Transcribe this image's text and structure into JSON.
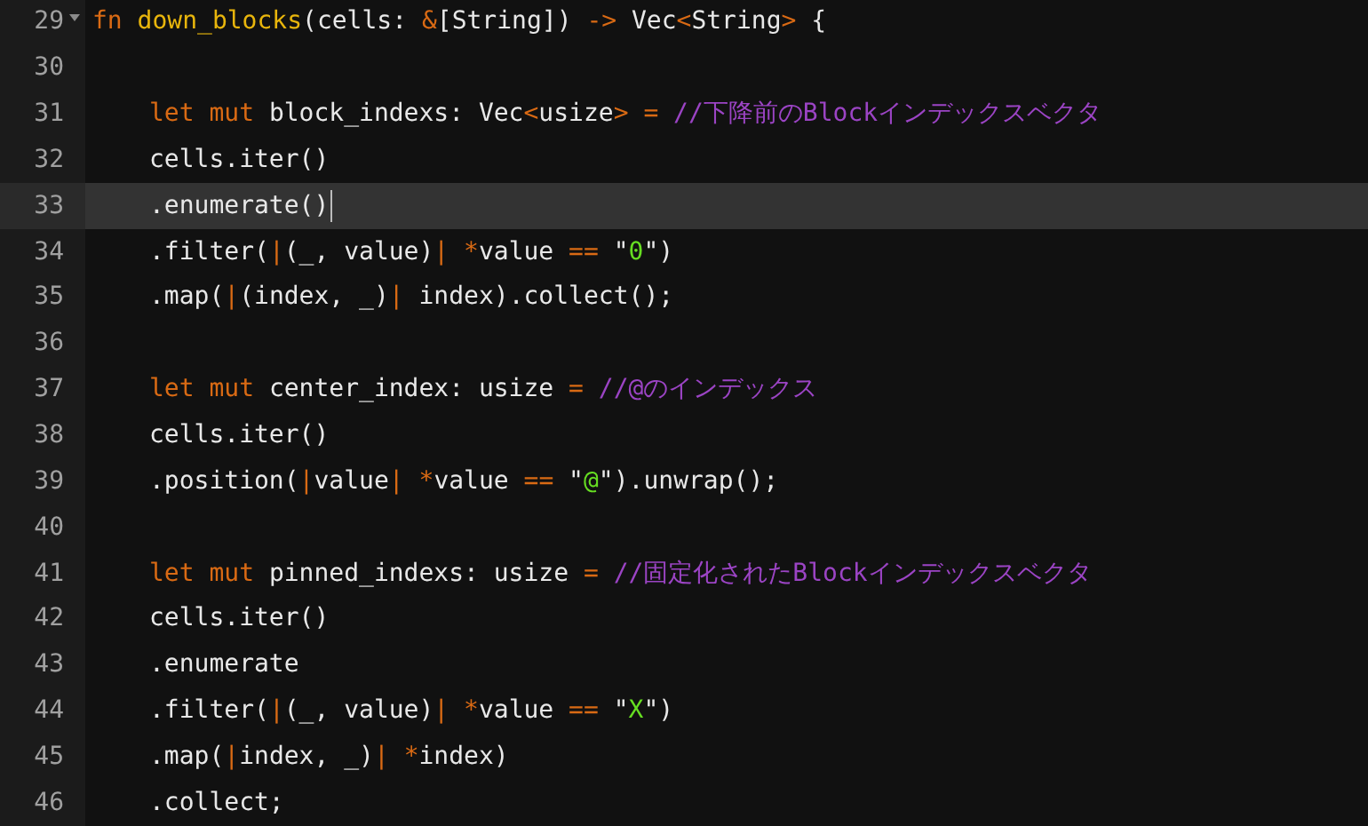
{
  "editor": {
    "lines": [
      {
        "number": "29",
        "foldable": true,
        "current": false,
        "indented": false,
        "tokens": [
          {
            "kind": "keyword",
            "text": "fn "
          },
          {
            "kind": "function",
            "text": "down_blocks"
          },
          {
            "kind": "plain",
            "text": "(cells: "
          },
          {
            "kind": "operator",
            "text": "&"
          },
          {
            "kind": "plain",
            "text": "[String]) "
          },
          {
            "kind": "operator",
            "text": "->"
          },
          {
            "kind": "plain",
            "text": " Vec"
          },
          {
            "kind": "operator",
            "text": "<"
          },
          {
            "kind": "plain",
            "text": "String"
          },
          {
            "kind": "operator",
            "text": ">"
          },
          {
            "kind": "plain",
            "text": " {"
          }
        ]
      },
      {
        "number": "30",
        "foldable": false,
        "current": false
      },
      {
        "number": "31",
        "foldable": false,
        "current": false,
        "indented": true,
        "tokens": [
          {
            "kind": "keyword",
            "text": "let mut"
          },
          {
            "kind": "plain",
            "text": " block_indexs: Vec"
          },
          {
            "kind": "operator",
            "text": "<"
          },
          {
            "kind": "plain",
            "text": "usize"
          },
          {
            "kind": "operator",
            "text": "> "
          },
          {
            "kind": "operator",
            "text": "= "
          },
          {
            "kind": "comment",
            "text": "//下降前のBlockインデックスベクタ"
          }
        ]
      },
      {
        "number": "32",
        "foldable": false,
        "current": false,
        "indented": true,
        "tokens": [
          {
            "kind": "plain",
            "text": "cells.iter()"
          }
        ]
      },
      {
        "number": "33",
        "foldable": false,
        "current": true,
        "indented": true,
        "tokens": [
          {
            "kind": "plain",
            "text": ".enumerate()"
          }
        ]
      },
      {
        "number": "34",
        "foldable": false,
        "current": false,
        "indented": true,
        "tokens": [
          {
            "kind": "plain",
            "text": ".filter("
          },
          {
            "kind": "operator",
            "text": "|"
          },
          {
            "kind": "plain",
            "text": "(_, value)"
          },
          {
            "kind": "operator",
            "text": "| "
          },
          {
            "kind": "operator",
            "text": "*"
          },
          {
            "kind": "plain",
            "text": "value "
          },
          {
            "kind": "operator",
            "text": "=="
          },
          {
            "kind": "plain",
            "text": " \""
          },
          {
            "kind": "string",
            "text": "0"
          },
          {
            "kind": "plain",
            "text": "\")"
          }
        ]
      },
      {
        "number": "35",
        "foldable": false,
        "current": false,
        "indented": true,
        "tokens": [
          {
            "kind": "plain",
            "text": ".map("
          },
          {
            "kind": "operator",
            "text": "|"
          },
          {
            "kind": "plain",
            "text": "(index, _)"
          },
          {
            "kind": "operator",
            "text": "|"
          },
          {
            "kind": "plain",
            "text": " index).collect();"
          }
        ]
      },
      {
        "number": "36",
        "foldable": false,
        "current": false
      },
      {
        "number": "37",
        "foldable": false,
        "current": false,
        "indented": true,
        "tokens": [
          {
            "kind": "keyword",
            "text": "let mut"
          },
          {
            "kind": "plain",
            "text": " center_index: usize "
          },
          {
            "kind": "operator",
            "text": "= "
          },
          {
            "kind": "comment",
            "text": "//@のインデックス"
          }
        ]
      },
      {
        "number": "38",
        "foldable": false,
        "current": false,
        "indented": true,
        "tokens": [
          {
            "kind": "plain",
            "text": "cells.iter()"
          }
        ]
      },
      {
        "number": "39",
        "foldable": false,
        "current": false,
        "indented": true,
        "tokens": [
          {
            "kind": "plain",
            "text": ".position("
          },
          {
            "kind": "operator",
            "text": "|"
          },
          {
            "kind": "plain",
            "text": "value"
          },
          {
            "kind": "operator",
            "text": "| "
          },
          {
            "kind": "operator",
            "text": "*"
          },
          {
            "kind": "plain",
            "text": "value "
          },
          {
            "kind": "operator",
            "text": "=="
          },
          {
            "kind": "plain",
            "text": " \""
          },
          {
            "kind": "string",
            "text": "@"
          },
          {
            "kind": "plain",
            "text": "\").unwrap();"
          }
        ]
      },
      {
        "number": "40",
        "foldable": false,
        "current": false
      },
      {
        "number": "41",
        "foldable": false,
        "current": false,
        "indented": true,
        "tokens": [
          {
            "kind": "keyword",
            "text": "let mut"
          },
          {
            "kind": "plain",
            "text": " pinned_indexs: usize "
          },
          {
            "kind": "operator",
            "text": "= "
          },
          {
            "kind": "comment",
            "text": "//固定化されたBlockインデックスベクタ"
          }
        ]
      },
      {
        "number": "42",
        "foldable": false,
        "current": false,
        "indented": true,
        "tokens": [
          {
            "kind": "plain",
            "text": "cells.iter()"
          }
        ]
      },
      {
        "number": "43",
        "foldable": false,
        "current": false,
        "indented": true,
        "tokens": [
          {
            "kind": "plain",
            "text": ".enumerate"
          }
        ]
      },
      {
        "number": "44",
        "foldable": false,
        "current": false,
        "indented": true,
        "tokens": [
          {
            "kind": "plain",
            "text": ".filter("
          },
          {
            "kind": "operator",
            "text": "|"
          },
          {
            "kind": "plain",
            "text": "(_, value)"
          },
          {
            "kind": "operator",
            "text": "| "
          },
          {
            "kind": "operator",
            "text": "*"
          },
          {
            "kind": "plain",
            "text": "value "
          },
          {
            "kind": "operator",
            "text": "=="
          },
          {
            "kind": "plain",
            "text": " \""
          },
          {
            "kind": "string",
            "text": "X"
          },
          {
            "kind": "plain",
            "text": "\")"
          }
        ]
      },
      {
        "number": "45",
        "foldable": false,
        "current": false,
        "indented": true,
        "tokens": [
          {
            "kind": "plain",
            "text": ".map("
          },
          {
            "kind": "operator",
            "text": "|"
          },
          {
            "kind": "plain",
            "text": "index, _)"
          },
          {
            "kind": "operator",
            "text": "| "
          },
          {
            "kind": "operator",
            "text": "*"
          },
          {
            "kind": "plain",
            "text": "index)"
          }
        ]
      },
      {
        "number": "46",
        "foldable": false,
        "current": false,
        "indented": true,
        "tokens": [
          {
            "kind": "plain",
            "text": ".collect;"
          }
        ]
      }
    ]
  }
}
